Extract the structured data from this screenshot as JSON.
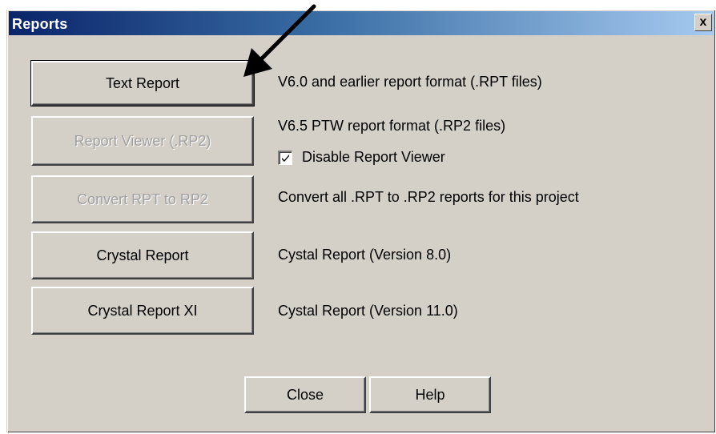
{
  "window": {
    "title": "Reports",
    "close_label": "x"
  },
  "rows": [
    {
      "button_label": "Text Report",
      "description": "V6.0 and earlier report format (.RPT files)",
      "enabled": true
    },
    {
      "button_label": "Report Viewer (.RP2)",
      "description": "V6.5 PTW report format (.RP2 files)",
      "enabled": false
    },
    {
      "button_label": "Convert RPT to RP2",
      "description": "Convert all .RPT to .RP2 reports for this project",
      "enabled": false
    },
    {
      "button_label": "Crystal Report",
      "description": "Cystal Report (Version 8.0)",
      "enabled": true
    },
    {
      "button_label": "Crystal Report XI",
      "description": "Cystal Report (Version 11.0)",
      "enabled": true
    }
  ],
  "checkbox": {
    "label": "Disable Report Viewer",
    "checked": true
  },
  "footer": {
    "close_label": "Close",
    "help_label": "Help"
  },
  "colors": {
    "title_gradient_start": "#0a246a",
    "title_gradient_end": "#a6caf0",
    "dialog_bg": "#d4d0c8"
  },
  "icons": {
    "close": "close-icon",
    "check": "check-icon",
    "annotation": "arrow-annotation"
  }
}
